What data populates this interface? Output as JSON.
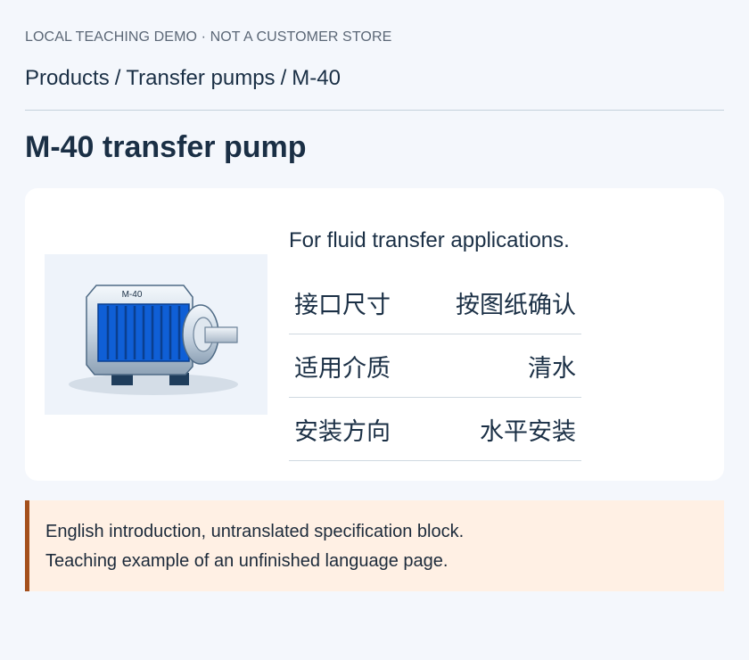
{
  "demo_label": "LOCAL TEACHING DEMO · NOT A CUSTOMER STORE",
  "breadcrumb": [
    "Products",
    "Transfer pumps",
    "M-40"
  ],
  "breadcrumb_separator": "/",
  "page_title": "M-40 transfer pump",
  "product": {
    "image_label": "M-40",
    "intro": "For fluid transfer applications.",
    "specs": [
      {
        "label": "接口尺寸",
        "value": "按图纸确认"
      },
      {
        "label": "适用介质",
        "value": "清水"
      },
      {
        "label": "安装方向",
        "value": "水平安装"
      }
    ]
  },
  "note": {
    "line1": "English introduction, untranslated specification block.",
    "line2": "Teaching example of an unfinished language page."
  },
  "colors": {
    "background": "#f4f7fc",
    "text": "#1a2f45",
    "note_background": "#fff0e4",
    "note_border": "#a4501c",
    "pump_blue": "#0f5fd6"
  }
}
